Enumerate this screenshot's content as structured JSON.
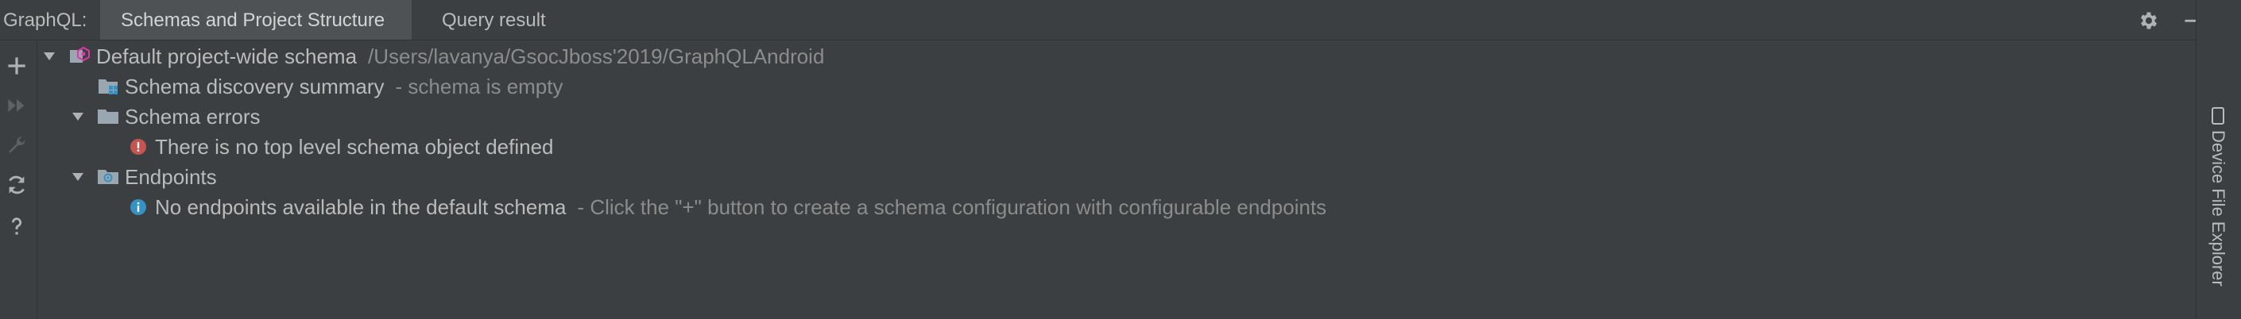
{
  "header": {
    "tool_label": "GraphQL:",
    "tabs": [
      {
        "label": "Schemas and Project Structure",
        "active": true
      },
      {
        "label": "Query result",
        "active": false
      }
    ]
  },
  "left_toolbar": {
    "icons": [
      "add-icon",
      "run-icon",
      "wrench-icon",
      "refresh-icon",
      "help-icon"
    ]
  },
  "tree": {
    "root": {
      "label": "Default project-wide schema",
      "path": "/Users/lavanya/GsocJboss'2019/GraphQLAndroid"
    },
    "discovery": {
      "label": "Schema discovery summary",
      "hint": "- schema is empty"
    },
    "errors": {
      "label": "Schema errors",
      "item": "There is no top level schema object defined"
    },
    "endpoints": {
      "label": "Endpoints",
      "item": "No endpoints available in the default schema",
      "hint": "- Click the \"+\" button to create a schema configuration with configurable endpoints"
    }
  },
  "right_sidebar": {
    "label": "Device File Explorer"
  },
  "colors": {
    "background": "#3c3f41",
    "active_tab": "#4e5254",
    "text": "#bbbbbb",
    "hint_text": "#8c8c8c",
    "error": "#c75450",
    "info": "#3592c4",
    "folder": "#9aa7b0"
  }
}
